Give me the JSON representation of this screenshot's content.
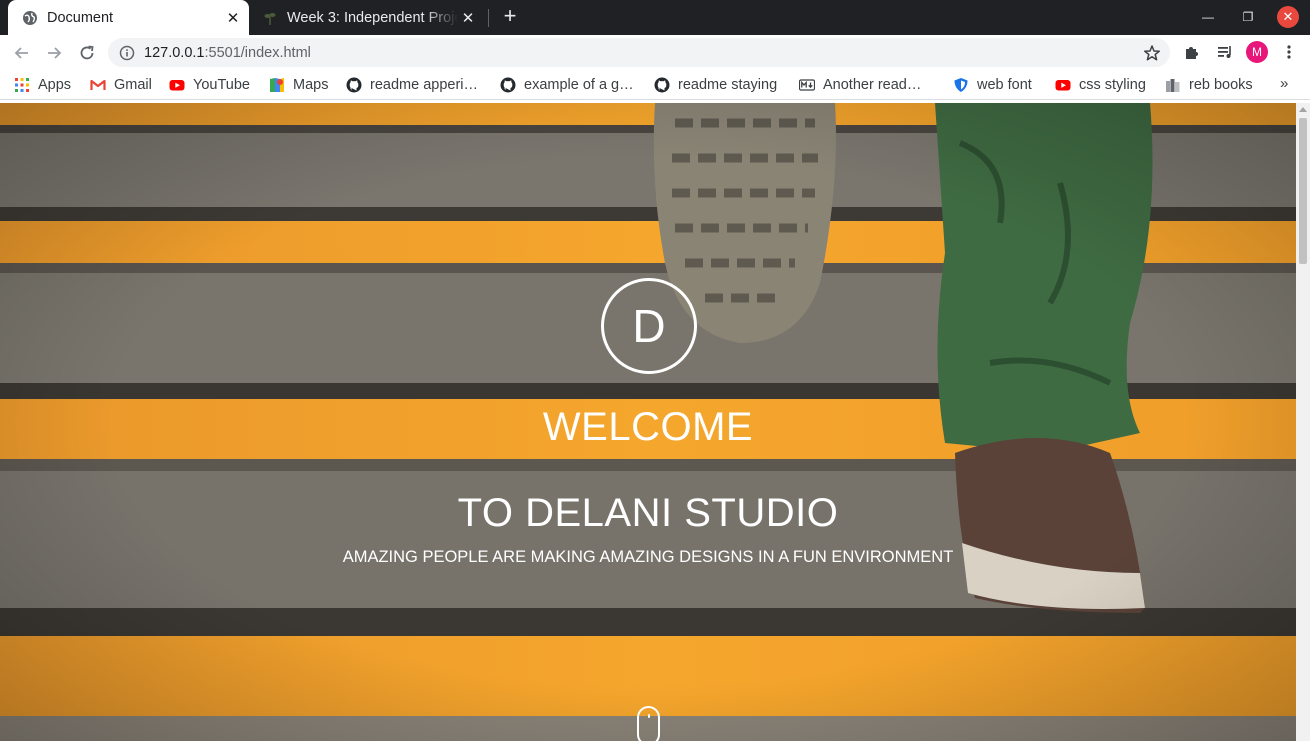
{
  "browser": {
    "tabs": [
      {
        "title": "Document",
        "active": true,
        "icon": "globe-icon"
      },
      {
        "title": "Week 3: Independent Project",
        "active": false,
        "icon": "plant-icon"
      }
    ],
    "new_tab_label": "+",
    "window_controls": {
      "minimize": "—",
      "maximize": "❐",
      "close": "✕"
    },
    "url_host": "127.0.0.1",
    "url_rest": ":5501/index.html",
    "profile_initial": "M"
  },
  "bookmarks": [
    {
      "label": "Apps",
      "icon": "apps-grid-icon"
    },
    {
      "label": "Gmail",
      "icon": "gmail-icon"
    },
    {
      "label": "YouTube",
      "icon": "youtube-icon"
    },
    {
      "label": "Maps",
      "icon": "maps-icon"
    },
    {
      "label": "readme apperi…",
      "icon": "github-icon"
    },
    {
      "label": "example of a g…",
      "icon": "github-icon"
    },
    {
      "label": "readme staying",
      "icon": "github-icon"
    },
    {
      "label": "Another read…",
      "icon": "markdown-icon"
    },
    {
      "label": "web font",
      "icon": "shield-icon"
    },
    {
      "label": "css styling",
      "icon": "youtube-icon"
    },
    {
      "label": "reb books",
      "icon": "books-icon"
    }
  ],
  "bookmarks_more": "»",
  "hero": {
    "logo_letter": "D",
    "welcome": "WELCOME",
    "studio": "TO DELANI STUDIO",
    "tagline": "AMAZING PEOPLE ARE MAKING AMAZING DESIGNS IN A FUN ENVIRONMENT"
  },
  "colors": {
    "chrome_dark": "#202124",
    "stair_yellow": "#f3a12a",
    "stair_grey": "#75716a",
    "avatar": "#e8157a"
  }
}
